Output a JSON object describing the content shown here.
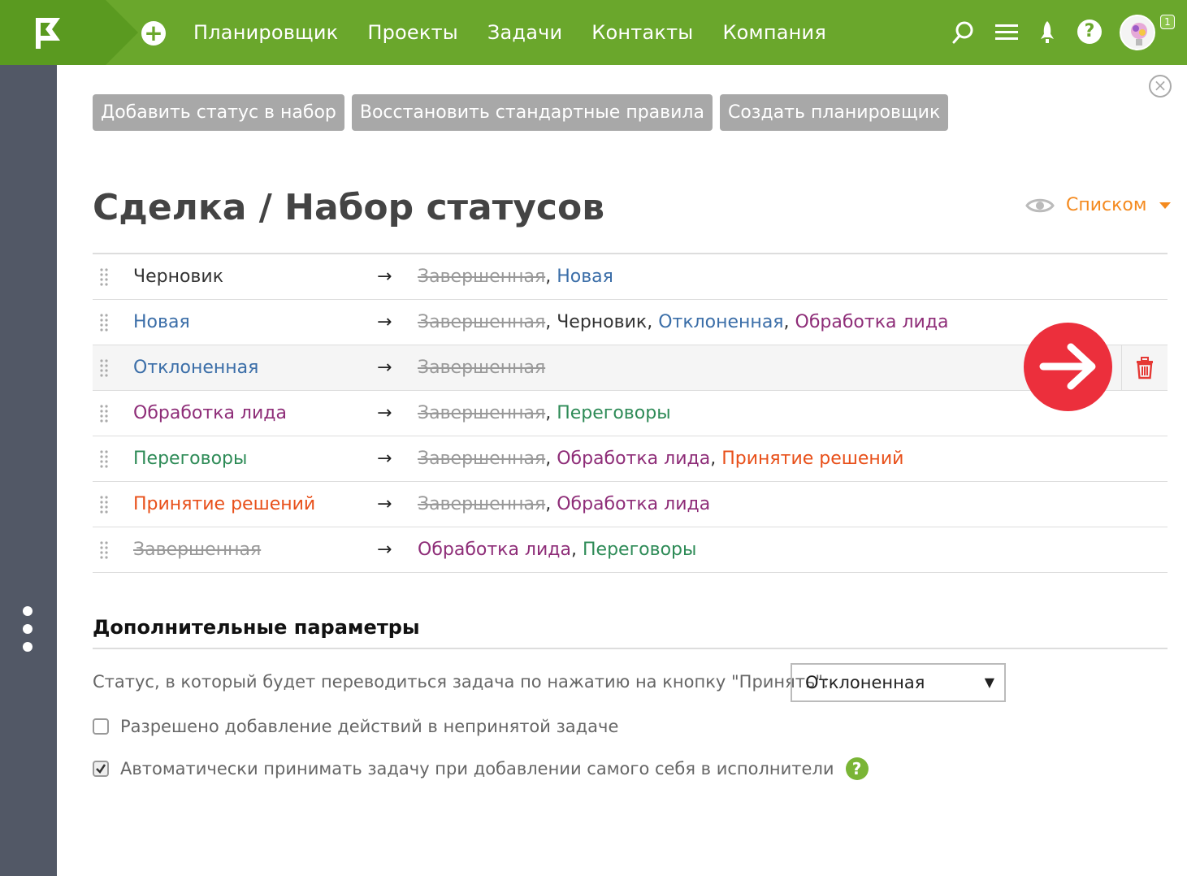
{
  "topbar": {
    "nav": [
      "Планировщик",
      "Проекты",
      "Задачи",
      "Контакты",
      "Компания"
    ],
    "notification_count": "1"
  },
  "toolbar": {
    "add_status": "Добавить статус в набор",
    "restore_rules": "Восстановить стандартные правила",
    "create_planner": "Создать планировщик"
  },
  "page": {
    "title": "Сделка / Набор статусов",
    "view_mode": "Списком"
  },
  "statuses": [
    {
      "name": "Черновик",
      "color": "black",
      "crossed": false,
      "targets": [
        {
          "label": "Завершенная",
          "crossed": true
        },
        {
          "label": "Новая",
          "color": "blue"
        }
      ]
    },
    {
      "name": "Новая",
      "color": "blue",
      "crossed": false,
      "targets": [
        {
          "label": "Завершенная",
          "crossed": true
        },
        {
          "label": "Черновик",
          "color": "black"
        },
        {
          "label": "Отклоненная",
          "color": "blue"
        },
        {
          "label": "Обработка лида",
          "color": "purple"
        }
      ]
    },
    {
      "name": "Отклоненная",
      "color": "blue",
      "crossed": false,
      "highlighted": true,
      "targets": [
        {
          "label": "Завершенная",
          "crossed": true
        }
      ]
    },
    {
      "name": "Обработка лида",
      "color": "purple",
      "crossed": false,
      "targets": [
        {
          "label": "Завершенная",
          "crossed": true
        },
        {
          "label": "Переговоры",
          "color": "green"
        }
      ]
    },
    {
      "name": "Переговоры",
      "color": "green",
      "crossed": false,
      "targets": [
        {
          "label": "Завершенная",
          "crossed": true
        },
        {
          "label": "Обработка лида",
          "color": "purple"
        },
        {
          "label": "Принятие решений",
          "color": "orange"
        }
      ]
    },
    {
      "name": "Принятие решений",
      "color": "orange",
      "crossed": false,
      "targets": [
        {
          "label": "Завершенная",
          "crossed": true
        },
        {
          "label": "Обработка лида",
          "color": "purple"
        }
      ]
    },
    {
      "name": "Завершенная",
      "color": "grey",
      "crossed": true,
      "targets": [
        {
          "label": "Обработка лида",
          "color": "purple"
        },
        {
          "label": "Переговоры",
          "color": "green"
        }
      ]
    }
  ],
  "extra": {
    "title": "Дополнительные параметры",
    "accept_status_label": "Статус, в который будет переводиться задача по нажатию на кнопку \"Принять\":",
    "accept_status_value": "Отклоненная",
    "allow_actions_label": "Разрешено добавление действий в непринятой задаче",
    "allow_actions_checked": false,
    "auto_accept_label": "Автоматически принимать задачу при добавлении самого себя в исполнители",
    "auto_accept_checked": true
  },
  "colors": {
    "brand_green": "#6aa72c",
    "sidebar": "#525866",
    "accent_orange": "#f48a1f",
    "delete_red": "#e53935",
    "highlight_arrow": "#ec2f3c"
  },
  "icons": [
    "logo-flag-icon",
    "plus-icon",
    "search-icon",
    "menu-icon",
    "rocket-icon",
    "help-icon",
    "close-icon",
    "eye-icon",
    "drag-handle-icon",
    "arrow-right-icon",
    "trash-icon",
    "kebab-icon"
  ]
}
